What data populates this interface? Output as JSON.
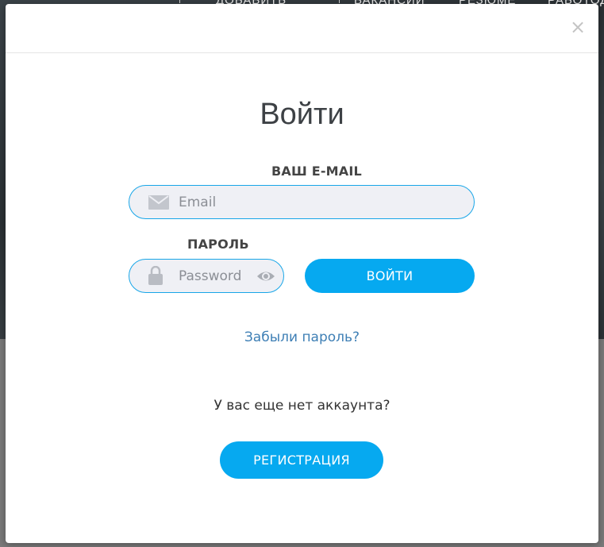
{
  "background": {
    "nav_items": [
      "ДОБАВИТЬ",
      "ВАКАНСИИ",
      "РЕЗЮМЕ",
      "РАБОТОД"
    ]
  },
  "modal": {
    "close_icon": "close-icon",
    "title": "Войти",
    "email": {
      "label": "ВАШ E-MAIL",
      "placeholder": "Email",
      "value": "",
      "icon": "mail-icon"
    },
    "password": {
      "label": "ПАРОЛЬ",
      "placeholder": "Password",
      "value": "",
      "icon": "lock-icon",
      "toggle_icon": "eye-icon"
    },
    "login_button": "ВОЙТИ",
    "forgot_link": "Забыли пароль?",
    "no_account_text": "У вас еще нет аккаунта?",
    "register_button": "РЕГИСТРАЦИЯ"
  },
  "colors": {
    "accent": "#06a9f0",
    "input_border": "#18a6e8",
    "link": "#3e7fb5",
    "input_bg": "#eff0f5"
  }
}
